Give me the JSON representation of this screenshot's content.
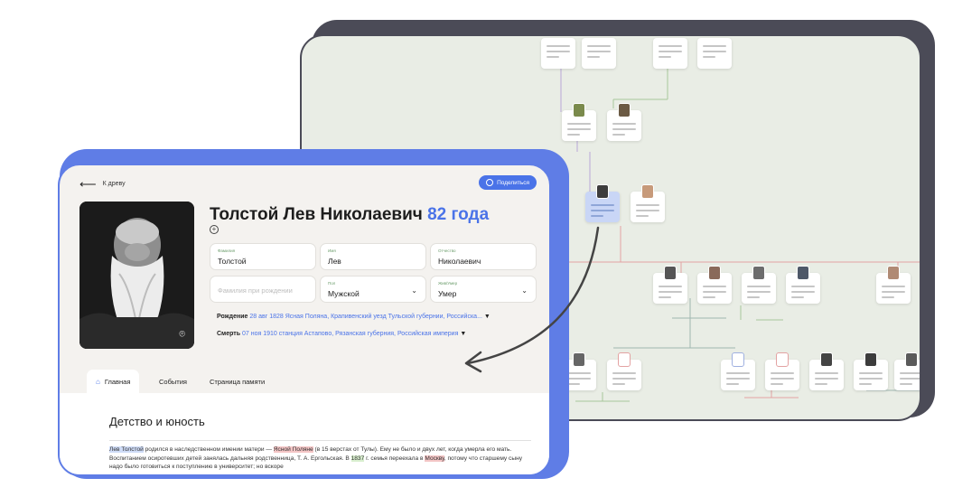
{
  "back_link": {
    "label": "К древу"
  },
  "share": {
    "label": "Поделиться"
  },
  "person": {
    "name": "Толстой Лев Николаевич",
    "age": "82 года"
  },
  "fields": {
    "surname": {
      "label": "Фамилия",
      "value": "Толстой"
    },
    "first_name": {
      "label": "Имя",
      "value": "Лев"
    },
    "patronymic": {
      "label": "Отчество",
      "value": "Николаевич"
    },
    "birth_surname": {
      "placeholder": "Фамилия при рождении"
    },
    "gender": {
      "label": "Пол",
      "value": "Мужской"
    },
    "status": {
      "label": "Жив/Умер",
      "value": "Умер"
    }
  },
  "birth": {
    "label": "Рождение",
    "date": "28 авг 1828",
    "place": "Ясная Поляна, Крапивенский уезд Тульской губернии, Российска..."
  },
  "death": {
    "label": "Смерть",
    "date": "07 ноя 1910",
    "place": "станция Астапово, Рязанская губерния, Российская империя"
  },
  "tabs": [
    {
      "label": "Главная"
    },
    {
      "label": "События"
    },
    {
      "label": "Страница памяти"
    }
  ],
  "article": {
    "title": "Детство и юность",
    "p_a": "Лев Толстой",
    "p_b": " родился в наследственном имении матери — ",
    "p_c": "Ясной Поляне",
    "p_d": " (в 15 верстах от Тулы). Ему не было и двух лет, когда умерла его мать. Воспитанием осиротевших детей занялась дальняя родственница, Т. А. Ергольская. В ",
    "p_e": "1837",
    "p_f": " г. семья переехала в ",
    "p_g": "Москву",
    "p_h": ", потому что старшему сыну надо было готовиться к поступлению в университет; но вскоре"
  },
  "icons": [
    "back-arrow-icon",
    "globe-icon",
    "camera-icon",
    "add-icon",
    "chevron-down-icon",
    "home-icon"
  ],
  "colors": {
    "accent": "#4a73e8",
    "card_border": "#5f7de6",
    "frame_dark": "#4b4b57"
  }
}
